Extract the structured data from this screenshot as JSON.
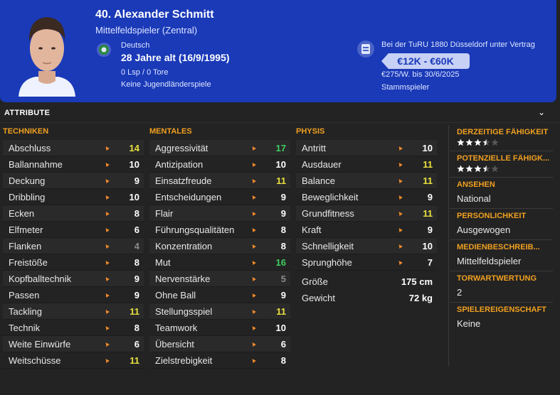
{
  "header": {
    "name": "40. Alexander Schmitt",
    "position": "Mittelfeldspieler (Zentral)",
    "nationality": "Deutsch",
    "age": "28 Jahre alt (16/9/1995)",
    "caps": "0 Lsp / 0 Tore",
    "youth": "Keine Jugendländerspiele",
    "contract": "Bei der TuRU 1880 Düsseldorf unter Vertrag",
    "value": "€12K - €60K",
    "wage": "€275/W. bis 30/6/2025",
    "role": "Stammspieler"
  },
  "section": {
    "title": "ATTRIBUTE"
  },
  "columns": {
    "technical": {
      "title": "TECHNIKEN",
      "rows": [
        {
          "label": "Abschluss",
          "value": "14"
        },
        {
          "label": "Ballannahme",
          "value": "10"
        },
        {
          "label": "Deckung",
          "value": "9"
        },
        {
          "label": "Dribbling",
          "value": "10"
        },
        {
          "label": "Ecken",
          "value": "8"
        },
        {
          "label": "Elfmeter",
          "value": "6"
        },
        {
          "label": "Flanken",
          "value": "4"
        },
        {
          "label": "Freistöße",
          "value": "8"
        },
        {
          "label": "Kopfballtechnik",
          "value": "9"
        },
        {
          "label": "Passen",
          "value": "9"
        },
        {
          "label": "Tackling",
          "value": "11"
        },
        {
          "label": "Technik",
          "value": "8"
        },
        {
          "label": "Weite Einwürfe",
          "value": "6"
        },
        {
          "label": "Weitschüsse",
          "value": "11"
        }
      ]
    },
    "mental": {
      "title": "MENTALES",
      "rows": [
        {
          "label": "Aggressivität",
          "value": "17"
        },
        {
          "label": "Antizipation",
          "value": "10"
        },
        {
          "label": "Einsatzfreude",
          "value": "11"
        },
        {
          "label": "Entscheidungen",
          "value": "9"
        },
        {
          "label": "Flair",
          "value": "9"
        },
        {
          "label": "Führungsqualitäten",
          "value": "8"
        },
        {
          "label": "Konzentration",
          "value": "8"
        },
        {
          "label": "Mut",
          "value": "16"
        },
        {
          "label": "Nervenstärke",
          "value": "5"
        },
        {
          "label": "Ohne Ball",
          "value": "9"
        },
        {
          "label": "Stellungsspiel",
          "value": "11"
        },
        {
          "label": "Teamwork",
          "value": "10"
        },
        {
          "label": "Übersicht",
          "value": "6"
        },
        {
          "label": "Zielstrebigkeit",
          "value": "8"
        }
      ]
    },
    "physical": {
      "title": "PHYSIS",
      "rows": [
        {
          "label": "Antritt",
          "value": "10"
        },
        {
          "label": "Ausdauer",
          "value": "11"
        },
        {
          "label": "Balance",
          "value": "11"
        },
        {
          "label": "Beweglichkeit",
          "value": "9"
        },
        {
          "label": "Grundfitness",
          "value": "11"
        },
        {
          "label": "Kraft",
          "value": "9"
        },
        {
          "label": "Schnelligkeit",
          "value": "10"
        },
        {
          "label": "Sprunghöhe",
          "value": "7"
        }
      ],
      "height_label": "Größe",
      "height_value": "175 cm",
      "weight_label": "Gewicht",
      "weight_value": "72 kg"
    }
  },
  "side": {
    "current_ability_title": "DERZEITIGE FÄHIGKEIT",
    "current_ability_stars": 3.5,
    "potential_title": "POTENZIELLE FÄHIGK...",
    "potential_stars": 3.5,
    "reputation_title": "ANSEHEN",
    "reputation_value": "National",
    "personality_title": "PERSÖNLICHKEIT",
    "personality_value": "Ausgewogen",
    "media_title": "MEDIENBESCHREIB...",
    "media_value": "Mittelfeldspieler",
    "gk_title": "TORWARTWERTUNG",
    "gk_value": "2",
    "traits_title": "SPIELEREIGENSCHAFT",
    "traits_value": "Keine"
  },
  "colors": {
    "header_bg": "#1a3ab8",
    "accent_orange": "#f0a020",
    "value_yellow": "#e8e040",
    "value_green": "#40d060",
    "value_grey": "#8a8a8a"
  }
}
